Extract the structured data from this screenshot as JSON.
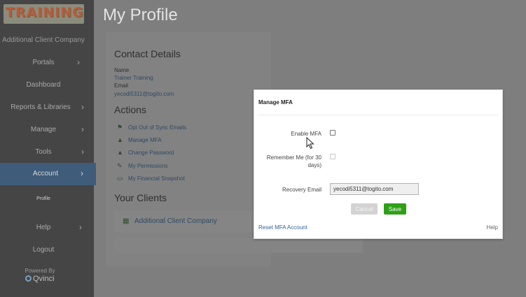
{
  "sidebar": {
    "logo_text": "TRAINING",
    "company": "Additional Client Company",
    "items": [
      {
        "label": "Portals",
        "chevron": "›"
      },
      {
        "label": "Dashboard",
        "chevron": ""
      },
      {
        "label": "Reports & Libraries",
        "chevron": "›"
      },
      {
        "label": "Manage",
        "chevron": "›"
      },
      {
        "label": "Tools",
        "chevron": "›"
      },
      {
        "label": "Account",
        "chevron": "›"
      },
      {
        "label": "Help",
        "chevron": "›"
      },
      {
        "label": "Logout",
        "chevron": ""
      }
    ],
    "sub_item": "Profile",
    "powered_by": "Powered By",
    "brand": "Qvinci"
  },
  "page": {
    "title": "My Profile",
    "contact": {
      "heading": "Contact Details",
      "name_label": "Name",
      "name_value": "Trainer Training",
      "email_label": "Email",
      "email_value": "yecodi5311@togito.com"
    },
    "actions": {
      "heading": "Actions",
      "items": [
        {
          "label": "Opt Out of Sync Emails",
          "icon": "flag-icon"
        },
        {
          "label": "Manage MFA",
          "icon": "lock-icon"
        },
        {
          "label": "Change Password",
          "icon": "lock-icon"
        },
        {
          "label": "My Permissions",
          "icon": "edit-icon"
        },
        {
          "label": "My Financial Snapshot",
          "icon": "monitor-icon"
        }
      ]
    },
    "clients": {
      "heading": "Your Clients",
      "items": [
        {
          "label": "Additional Client Company",
          "icon": "store-icon"
        }
      ]
    }
  },
  "modal": {
    "title": "Manage MFA",
    "enable_label": "Enable MFA",
    "enable_checked": false,
    "remember_label_1": "Remember Me (for 30",
    "remember_label_2": "days)",
    "remember_checked": false,
    "recovery_label": "Recovery Email",
    "recovery_value": "yecodi5311@togito.com",
    "cancel": "Cancel",
    "save": "Save",
    "reset_link": "Reset MFA Account",
    "help": "Help"
  },
  "colors": {
    "sidebar_bg": "#454545",
    "active_nav": "#3f5c7a",
    "save_green": "#2ea016",
    "link_blue": "#33639a"
  }
}
